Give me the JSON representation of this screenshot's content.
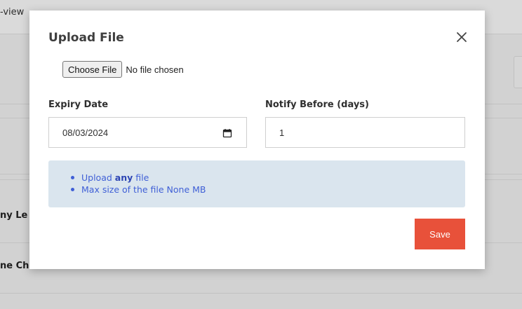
{
  "background": {
    "breadcrumb": "-view",
    "rows": [
      "ny Le",
      "ne Ch"
    ]
  },
  "modal": {
    "title": "Upload File",
    "file_input": {
      "button_label": "Choose File",
      "status": "No file chosen"
    },
    "expiry_date": {
      "label": "Expiry Date",
      "value": "08/03/2024"
    },
    "notify_before": {
      "label": "Notify Before (days)",
      "value": "1"
    },
    "info": {
      "line1_prefix": "Upload ",
      "line1_bold": "any",
      "line1_suffix": " file",
      "line2": "Max size of the file None MB"
    },
    "save_label": "Save"
  },
  "colors": {
    "accent": "#e8513a",
    "info_bg": "#dae5ee",
    "info_text": "#3f5fd6"
  },
  "icons": {
    "close": "close-icon",
    "calendar": "calendar-icon"
  }
}
